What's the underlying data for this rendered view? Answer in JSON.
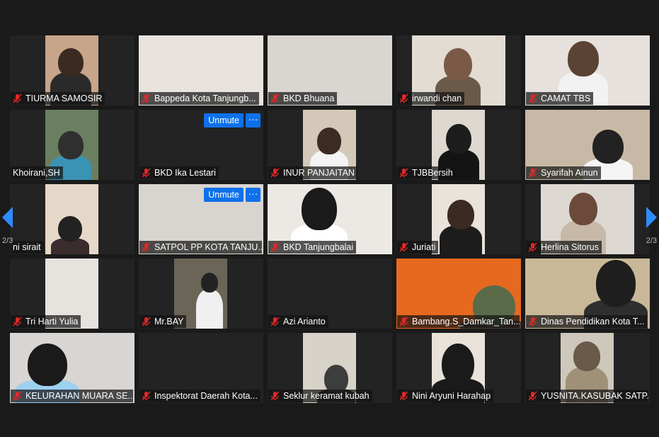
{
  "pagination": {
    "current": "2/3"
  },
  "controls": {
    "unmute_label": "Unmute",
    "more_label": "···"
  },
  "colors": {
    "accent": "#0e71eb",
    "arrow": "#2d8cff",
    "mic_muted": "#e02828",
    "background": "#1a1a1a"
  },
  "participants": [
    {
      "name": "TIURMA SAMOSIR",
      "muted": true
    },
    {
      "name": "Bappeda Kota Tanjungb...",
      "muted": true
    },
    {
      "name": "BKD Bhuana",
      "muted": true
    },
    {
      "name": "irwandi chan",
      "muted": true
    },
    {
      "name": "CAMAT TBS",
      "muted": true
    },
    {
      "name": "Khoirani,SH",
      "muted": false
    },
    {
      "name": "BKD Ika Lestari",
      "muted": true,
      "hover_controls": true
    },
    {
      "name": "INUR PANJAITAN",
      "muted": true
    },
    {
      "name": "TJBBersih",
      "muted": true
    },
    {
      "name": "Syarifah Ainun",
      "muted": true
    },
    {
      "name": "ni sirait",
      "muted": false
    },
    {
      "name": "SATPOL PP KOTA TANJU...",
      "muted": true,
      "hover_controls": true
    },
    {
      "name": "BKD Tanjungbalai",
      "muted": true
    },
    {
      "name": "Juriati",
      "muted": true
    },
    {
      "name": "Herlina Sitorus",
      "muted": true
    },
    {
      "name": "Tri Harti Yulia",
      "muted": true
    },
    {
      "name": "Mr.BAY",
      "muted": true
    },
    {
      "name": "Azi Arianto",
      "muted": true
    },
    {
      "name": "Bambang.S_Damkar_Tan...",
      "muted": true
    },
    {
      "name": "Dinas Pendidikan Kota T...",
      "muted": true
    },
    {
      "name": "KELURAHAN MUARA SE...",
      "muted": true
    },
    {
      "name": "Inspektorat Daerah Kota...",
      "muted": true
    },
    {
      "name": "Seklur keramat kubah",
      "muted": true
    },
    {
      "name": "Nini Aryuni Harahap",
      "muted": true
    },
    {
      "name": "YUSNITA.KASUBAK SATP...",
      "muted": true
    }
  ]
}
